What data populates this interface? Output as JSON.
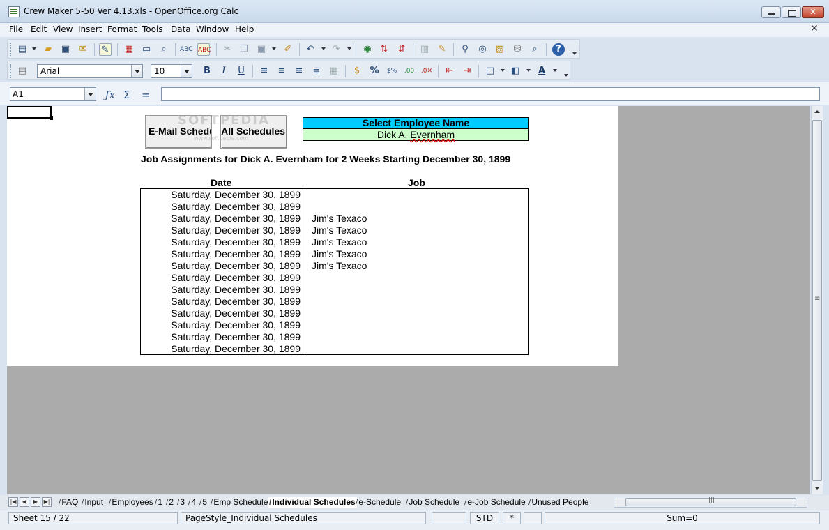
{
  "window": {
    "title": "Crew Maker 5-50 Ver 4.13.xls - OpenOffice.org Calc",
    "close_glyph": "✕",
    "doc_close_glyph": "✕"
  },
  "menu": [
    "File",
    "Edit",
    "View",
    "Insert",
    "Format",
    "Tools",
    "Data",
    "Window",
    "Help"
  ],
  "toolbar_format": {
    "font_name": "Arial",
    "font_size": "10",
    "bold": "B",
    "italic": "I",
    "underline": "U",
    "percent": "%"
  },
  "formula_bar": {
    "cell_ref": "A1",
    "formula": ""
  },
  "sheet": {
    "button_email": "E-Mail Schedule",
    "button_printall": "Print All Schedules",
    "watermark": "SOFTPEDIA",
    "watermark_sub": "www.softpedia.com",
    "select_header": "Select Employee Name",
    "select_value_first": "Dick A. ",
    "select_value_last": "Evernham",
    "heading": "Job Assignments for Dick A. Evernham for 2 Weeks Starting December 30, 1899",
    "col_date": "Date",
    "col_job": "Job",
    "rows": [
      {
        "date": "Saturday, December 30, 1899",
        "job": ""
      },
      {
        "date": "Saturday, December 30, 1899",
        "job": ""
      },
      {
        "date": "Saturday, December 30, 1899",
        "job": "Jim's Texaco"
      },
      {
        "date": "Saturday, December 30, 1899",
        "job": "Jim's Texaco"
      },
      {
        "date": "Saturday, December 30, 1899",
        "job": "Jim's Texaco"
      },
      {
        "date": "Saturday, December 30, 1899",
        "job": "Jim's Texaco"
      },
      {
        "date": "Saturday, December 30, 1899",
        "job": "Jim's Texaco"
      },
      {
        "date": "Saturday, December 30, 1899",
        "job": ""
      },
      {
        "date": "Saturday, December 30, 1899",
        "job": ""
      },
      {
        "date": "Saturday, December 30, 1899",
        "job": ""
      },
      {
        "date": "Saturday, December 30, 1899",
        "job": ""
      },
      {
        "date": "Saturday, December 30, 1899",
        "job": ""
      },
      {
        "date": "Saturday, December 30, 1899",
        "job": ""
      },
      {
        "date": "Saturday, December 30, 1899",
        "job": ""
      }
    ]
  },
  "tabs": [
    "FAQ",
    "Input",
    "Employees",
    "1",
    "2",
    "3",
    "4",
    "5",
    "Emp Schedule",
    "Individual Schedules",
    "e-Schedule",
    "Job Schedule",
    "e-Job Schedule",
    "Unused People"
  ],
  "active_tab": "Individual Schedules",
  "status": {
    "sheet": "Sheet 15 / 22",
    "page_style": "PageStyle_Individual Schedules",
    "mode": "STD",
    "modified": "*",
    "sum": "Sum=0"
  },
  "colors": {
    "select_header_bg": "#00ccff",
    "select_value_bg": "#ccffcc",
    "workspace_bg": "#ababab"
  }
}
